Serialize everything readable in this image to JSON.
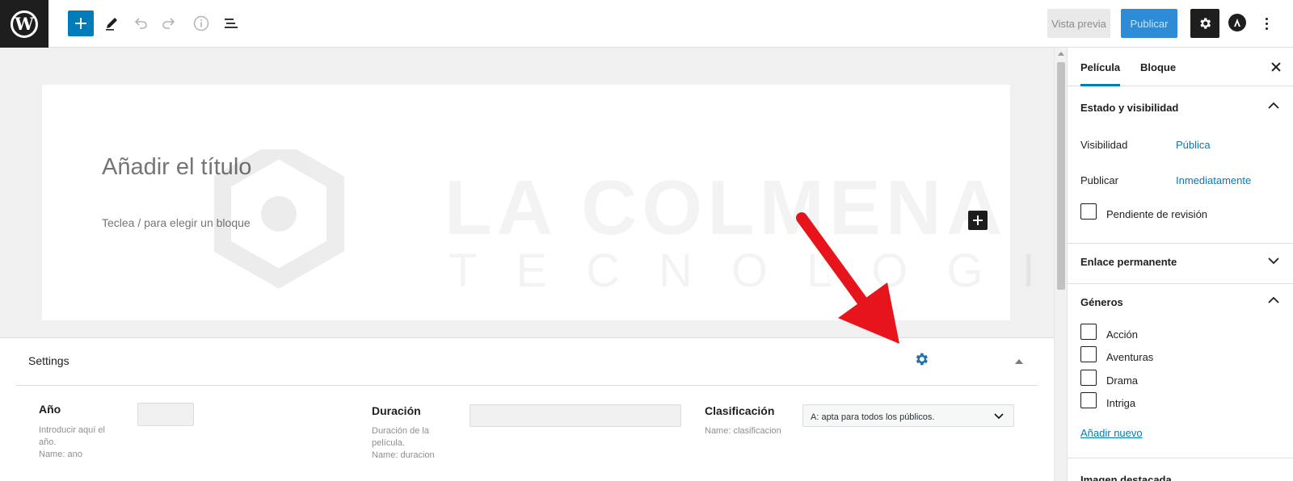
{
  "toolbar": {
    "preview_label": "Vista previa",
    "publish_label": "Publicar",
    "icons": [
      "wordpress-logo-icon",
      "plus-icon",
      "pencil-icon",
      "undo-icon",
      "redo-icon",
      "info-icon",
      "list-view-icon",
      "gear-icon",
      "astra-icon",
      "more-vertical-icon"
    ]
  },
  "editor": {
    "title_placeholder": "Añadir el título",
    "block_hint": "Teclea / para elegir un bloque"
  },
  "watermark": {
    "line1": "LA COLMENA",
    "line2": "TECNOLOGICA"
  },
  "metabox": {
    "title": "Settings",
    "fields": [
      {
        "label": "Año",
        "desc_lines": [
          "Introducir aquí el",
          "año.",
          "Name: ano"
        ],
        "value": ""
      },
      {
        "label": "Duración",
        "desc_lines": [
          "Duración de la",
          "película.",
          "Name: duracion"
        ],
        "value": ""
      },
      {
        "label": "Clasificación",
        "desc_lines": [
          "Name: clasificacion"
        ],
        "value": "A: apta para todos los públicos."
      }
    ]
  },
  "sidebar": {
    "tabs": [
      "Película",
      "Bloque"
    ],
    "active_tab": "Película",
    "status_panel": {
      "title": "Estado y visibilidad",
      "visibility_label": "Visibilidad",
      "visibility_value": "Pública",
      "publish_label": "Publicar",
      "publish_value": "Inmediatamente",
      "pending_label": "Pendiente de revisión"
    },
    "permalink_panel": {
      "title": "Enlace permanente"
    },
    "genres_panel": {
      "title": "Géneros",
      "items": [
        "Acción",
        "Aventuras",
        "Drama",
        "Intriga"
      ],
      "add_new": "Añadir nuevo"
    },
    "featured_image_panel": {
      "title": "Imagen destacada"
    }
  },
  "colors": {
    "accent": "#007cba",
    "dark": "#1e1e1e",
    "arrow": "#e8141c"
  }
}
